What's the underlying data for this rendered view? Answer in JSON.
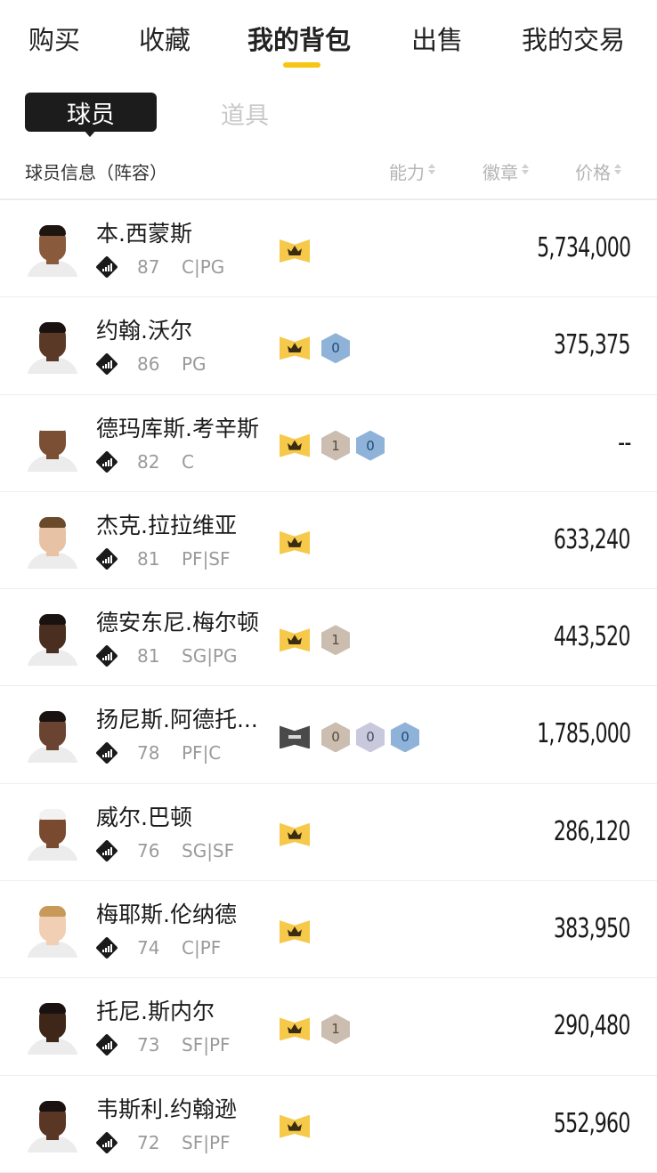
{
  "top_tabs": [
    {
      "label": "购买",
      "active": false
    },
    {
      "label": "收藏",
      "active": false
    },
    {
      "label": "我的背包",
      "active": true
    },
    {
      "label": "出售",
      "active": false
    },
    {
      "label": "我的交易",
      "active": false
    }
  ],
  "accent_color": "#f7c514",
  "segment": {
    "active": "球员",
    "inactive": "道具"
  },
  "columns": {
    "info": "球员信息（阵容）",
    "ability": "能力",
    "badge": "徽章",
    "price": "价格"
  },
  "players": [
    {
      "name": "本.西蒙斯",
      "rating": "87",
      "position": "C|PG",
      "price": "5,734,000",
      "badges": [
        {
          "type": "crown"
        }
      ]
    },
    {
      "name": "约翰.沃尔",
      "rating": "86",
      "position": "PG",
      "price": "375,375",
      "badges": [
        {
          "type": "crown"
        },
        {
          "type": "hex",
          "color": "blue",
          "text": "0"
        }
      ]
    },
    {
      "name": "德玛库斯.考辛斯",
      "rating": "82",
      "position": "C",
      "price": "--",
      "badges": [
        {
          "type": "crown"
        },
        {
          "type": "hex",
          "color": "brown",
          "text": "1"
        },
        {
          "type": "hex",
          "color": "blue",
          "text": "0"
        }
      ]
    },
    {
      "name": "杰克.拉拉维亚",
      "rating": "81",
      "position": "PF|SF",
      "price": "633,240",
      "badges": [
        {
          "type": "crown"
        }
      ]
    },
    {
      "name": "德安东尼.梅尔顿",
      "rating": "81",
      "position": "SG|PG",
      "price": "443,520",
      "badges": [
        {
          "type": "crown"
        },
        {
          "type": "hex",
          "color": "brown",
          "text": "1"
        }
      ]
    },
    {
      "name": "扬尼斯.阿德托...",
      "rating": "78",
      "position": "PF|C",
      "price": "1,785,000",
      "badges": [
        {
          "type": "minus"
        },
        {
          "type": "hex",
          "color": "brown",
          "text": "0"
        },
        {
          "type": "hex",
          "color": "lav",
          "text": "0"
        },
        {
          "type": "hex",
          "color": "blue",
          "text": "0"
        }
      ]
    },
    {
      "name": "威尔.巴顿",
      "rating": "76",
      "position": "SG|SF",
      "price": "286,120",
      "badges": [
        {
          "type": "crown"
        }
      ]
    },
    {
      "name": "梅耶斯.伦纳德",
      "rating": "74",
      "position": "C|PF",
      "price": "383,950",
      "badges": [
        {
          "type": "crown"
        }
      ]
    },
    {
      "name": "托尼.斯内尔",
      "rating": "73",
      "position": "SF|PF",
      "price": "290,480",
      "badges": [
        {
          "type": "crown"
        },
        {
          "type": "hex",
          "color": "brown",
          "text": "1"
        }
      ]
    },
    {
      "name": "韦斯利.约翰逊",
      "rating": "72",
      "position": "SF|PF",
      "price": "552,960",
      "badges": [
        {
          "type": "crown"
        }
      ]
    }
  ]
}
